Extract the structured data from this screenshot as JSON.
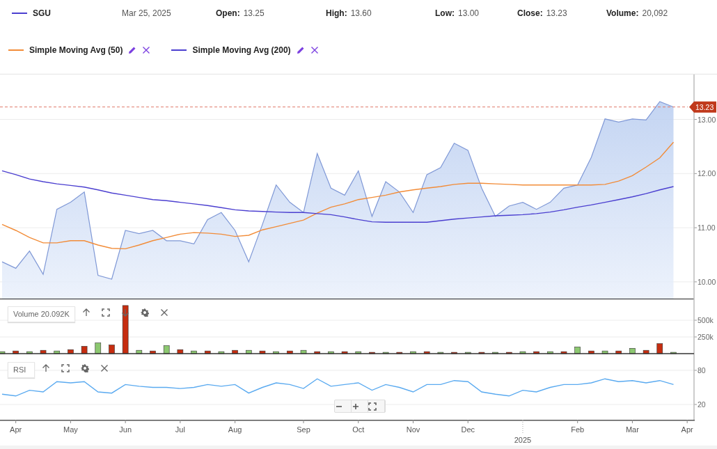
{
  "quote": {
    "date": "Mar 25, 2025",
    "fields": [
      {
        "label": "Open:",
        "value": "13.25"
      },
      {
        "label": "High:",
        "value": "13.60"
      },
      {
        "label": "Low:",
        "value": "13.00"
      },
      {
        "label": "Close:",
        "value": "13.23"
      },
      {
        "label": "Volume:",
        "value": "20,092"
      }
    ]
  },
  "price_chart": {
    "chart_data": {
      "type": "line",
      "grid": true,
      "categories": [
        null,
        null,
        null,
        null,
        null,
        null,
        null,
        null,
        null,
        null,
        null,
        null,
        null,
        null,
        null,
        null,
        null,
        null,
        null,
        null,
        null,
        null,
        null,
        null,
        null,
        null,
        null,
        null,
        null,
        null,
        null,
        null,
        null,
        null,
        null,
        null,
        null,
        null,
        null,
        null,
        null,
        null,
        null,
        null,
        null,
        null,
        null,
        null,
        null,
        null,
        null
      ],
      "ylim": [
        9.69,
        13.83
      ],
      "yticks": [
        {
          "value": 10,
          "label": "10.00"
        },
        {
          "value": 11,
          "label": "11.00"
        },
        {
          "value": 12,
          "label": "12.00"
        },
        {
          "value": 13,
          "label": "13.00"
        }
      ],
      "series": [
        {
          "name": "SGU",
          "type": "area",
          "color": "#7f98d6",
          "values": [
            10.37,
            10.25,
            10.57,
            10.14,
            11.34,
            11.47,
            11.66,
            10.12,
            10.05,
            10.95,
            10.89,
            10.95,
            10.76,
            10.76,
            10.7,
            11.15,
            11.28,
            10.95,
            10.37,
            11.06,
            11.79,
            11.47,
            11.28,
            12.37,
            11.73,
            11.6,
            12.05,
            11.21,
            11.85,
            11.66,
            11.28,
            11.98,
            12.11,
            12.56,
            12.43,
            11.73,
            11.21,
            11.4,
            11.47,
            11.34,
            11.47,
            11.73,
            11.79,
            12.3,
            13.01,
            12.95,
            13.01,
            12.99,
            13.33,
            13.23,
            null
          ]
        },
        {
          "name": "Simple Moving Avg (50)",
          "type": "line",
          "color": "#f28c38",
          "values": [
            11.06,
            10.95,
            10.82,
            10.72,
            10.72,
            10.76,
            10.76,
            10.68,
            10.62,
            10.61,
            10.68,
            10.76,
            10.82,
            10.88,
            10.91,
            10.9,
            10.88,
            10.84,
            10.86,
            10.96,
            11.02,
            11.08,
            11.14,
            11.27,
            11.38,
            11.44,
            11.52,
            11.56,
            11.6,
            11.66,
            11.7,
            11.73,
            11.76,
            11.8,
            11.82,
            11.82,
            11.81,
            11.8,
            11.79,
            11.79,
            11.79,
            11.79,
            11.79,
            11.79,
            11.8,
            11.86,
            11.96,
            12.12,
            12.29,
            12.58,
            null
          ]
        },
        {
          "name": "Simple Moving Avg (200)",
          "type": "line",
          "color": "#4b3fd0",
          "values": [
            12.05,
            11.98,
            11.9,
            11.85,
            11.81,
            11.78,
            11.75,
            11.7,
            11.64,
            11.6,
            11.56,
            11.52,
            11.5,
            11.47,
            11.44,
            11.41,
            11.37,
            11.33,
            11.31,
            11.3,
            11.29,
            11.28,
            11.28,
            11.26,
            11.24,
            11.2,
            11.15,
            11.11,
            11.1,
            11.1,
            11.1,
            11.1,
            11.13,
            11.16,
            11.18,
            11.2,
            11.22,
            11.23,
            11.24,
            11.26,
            11.29,
            11.33,
            11.38,
            11.42,
            11.47,
            11.52,
            11.57,
            11.63,
            11.7,
            11.76,
            null
          ]
        }
      ],
      "ref_lines": [
        {
          "axis": "y",
          "value": 13.23,
          "label": "13.23"
        }
      ]
    }
  },
  "volume_panel": {
    "label": "Volume 20.092K",
    "chart_data": {
      "type": "bar",
      "stacked": true,
      "grid": true,
      "categories": [
        null,
        null,
        null,
        null,
        null,
        null,
        null,
        null,
        null,
        null,
        null,
        null,
        null,
        null,
        null,
        null,
        null,
        null,
        null,
        null,
        null,
        null,
        null,
        null,
        null,
        null,
        null,
        null,
        null,
        null,
        null,
        null,
        null,
        null,
        null,
        null,
        null,
        null,
        null,
        null,
        null,
        null,
        null,
        null,
        null,
        null,
        null,
        null,
        null,
        null,
        null
      ],
      "ylim": [
        0,
        823
      ],
      "yticks": [
        {
          "value": 250,
          "label": "250k"
        },
        {
          "value": 500,
          "label": "500k"
        }
      ],
      "series": [
        {
          "color": "#8cc870",
          "values": [
            30,
            null,
            30,
            null,
            40,
            null,
            null,
            160,
            null,
            null,
            50,
            null,
            120,
            null,
            40,
            null,
            30,
            null,
            50,
            null,
            30,
            null,
            50,
            null,
            30,
            null,
            30,
            null,
            20,
            null,
            30,
            null,
            20,
            null,
            20,
            null,
            20,
            null,
            30,
            null,
            30,
            null,
            100,
            null,
            40,
            null,
            80,
            null,
            null,
            20,
            null
          ]
        },
        {
          "color": "#c62d10",
          "values": [
            null,
            40,
            null,
            50,
            null,
            60,
            110,
            null,
            130,
            720,
            null,
            40,
            null,
            60,
            null,
            40,
            null,
            50,
            null,
            40,
            null,
            40,
            null,
            30,
            null,
            30,
            null,
            20,
            null,
            20,
            null,
            30,
            null,
            20,
            null,
            20,
            null,
            20,
            null,
            30,
            null,
            30,
            null,
            40,
            null,
            40,
            null,
            50,
            150,
            null,
            null
          ]
        }
      ]
    }
  },
  "rsi_panel": {
    "chart_data": {
      "type": "line",
      "grid": true,
      "categories": [
        null,
        "Apr",
        null,
        null,
        null,
        "May",
        null,
        null,
        null,
        "Jun",
        null,
        null,
        null,
        "Jul",
        null,
        null,
        null,
        "Aug",
        null,
        null,
        null,
        null,
        "Sep",
        null,
        null,
        null,
        "Oct",
        null,
        null,
        null,
        "Nov",
        null,
        null,
        null,
        "Dec",
        null,
        null,
        null,
        null,
        null,
        null,
        null,
        "Feb",
        null,
        null,
        null,
        "Mar",
        null,
        null,
        null,
        "Apr"
      ],
      "ylim": [
        -6.9,
        106.9
      ],
      "yticks": [
        20,
        80
      ],
      "series": [
        {
          "name": "RSI",
          "color": "#5aaaf0",
          "values": [
            38,
            35,
            45,
            42,
            60,
            58,
            60,
            42,
            40,
            55,
            52,
            50,
            50,
            48,
            50,
            55,
            52,
            55,
            40,
            50,
            58,
            55,
            48,
            65,
            52,
            55,
            58,
            45,
            55,
            50,
            42,
            55,
            55,
            62,
            60,
            42,
            38,
            35,
            45,
            42,
            50,
            55,
            55,
            58,
            65,
            60,
            62,
            58,
            62,
            55,
            null
          ]
        }
      ],
      "annotations": [
        "2025"
      ]
    }
  }
}
